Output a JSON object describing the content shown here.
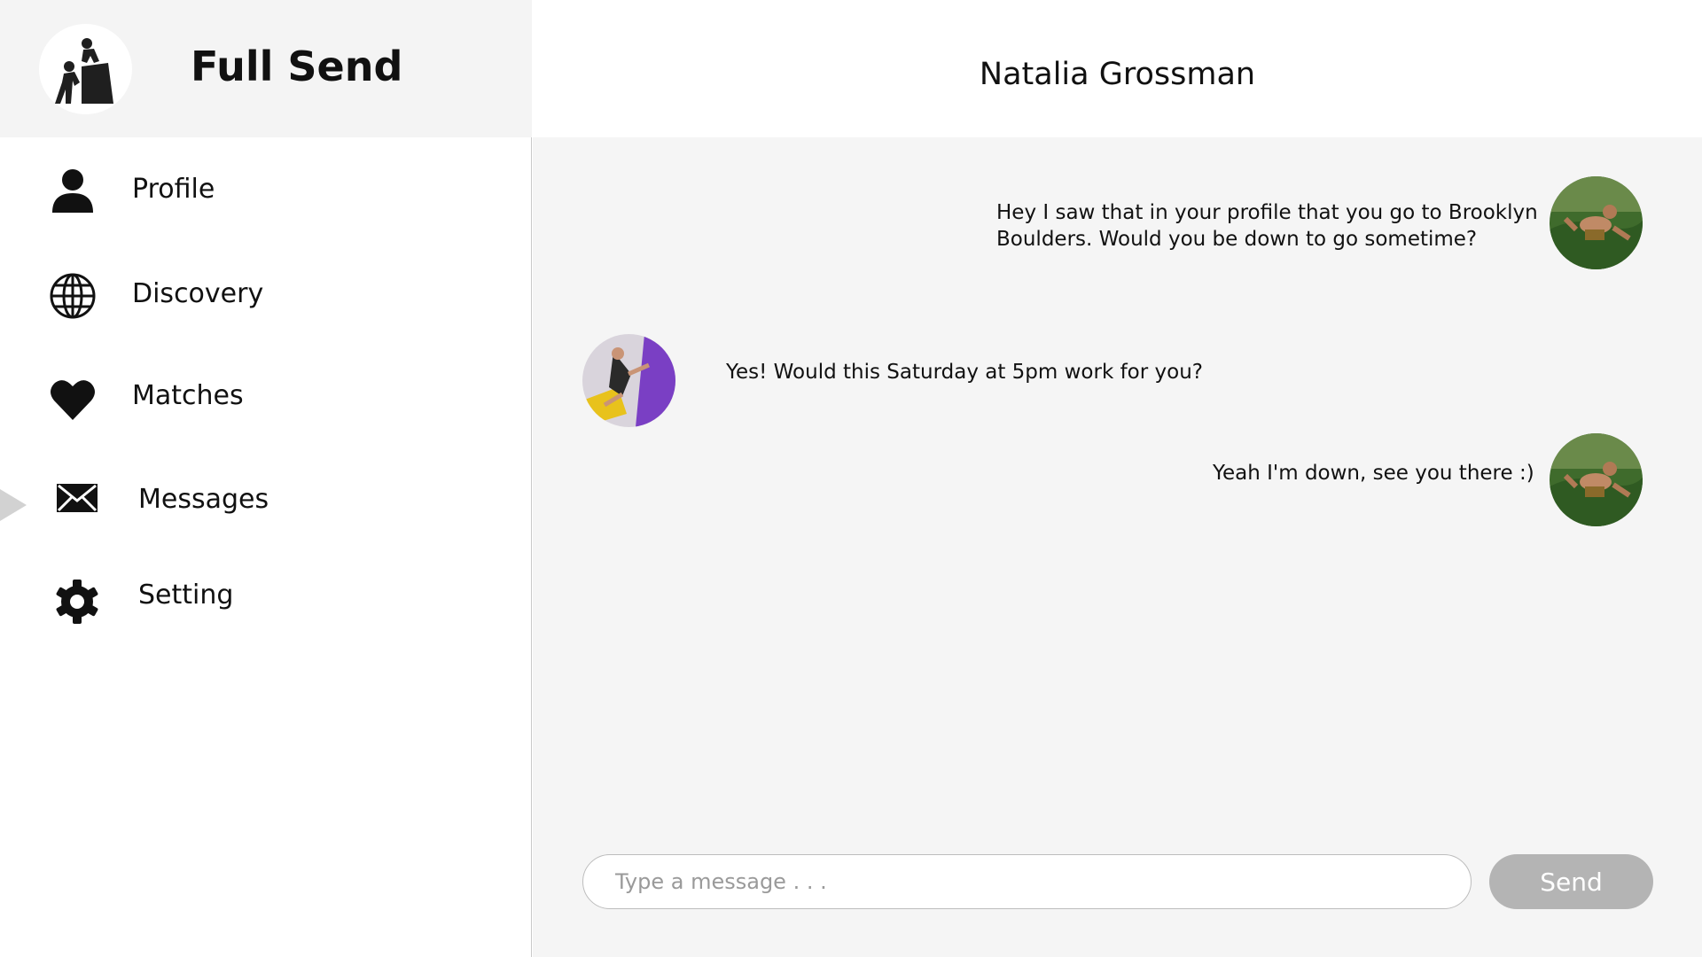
{
  "brand": {
    "name": "Full Send",
    "logo_icon": "climbers-logo-icon"
  },
  "nav": {
    "items": [
      {
        "label": "Profile",
        "icon": "person-icon"
      },
      {
        "label": "Discovery",
        "icon": "globe-icon"
      },
      {
        "label": "Matches",
        "icon": "heart-icon"
      },
      {
        "label": "Messages",
        "icon": "envelope-icon",
        "active": true
      },
      {
        "label": "Setting",
        "icon": "gear-icon"
      }
    ]
  },
  "chat": {
    "contact_name": "Natalia Grossman",
    "messages": [
      {
        "from": "me",
        "text_line1": "Hey I saw that in your profile that you go to Brooklyn",
        "text_line2": "Boulders. Would you be down to go sometime?"
      },
      {
        "from": "contact",
        "text": "Yes! Would this Saturday at 5pm work for you?"
      },
      {
        "from": "me",
        "text": "Yeah I'm down, see you there :)"
      }
    ]
  },
  "composer": {
    "placeholder": "Type a message . . .",
    "send_label": "Send"
  },
  "colors": {
    "sidebar_header_bg": "#f4f4f4",
    "chat_bg": "#f5f5f5",
    "send_button_bg": "#b4b4b4",
    "active_pointer": "#d2d2d2"
  }
}
